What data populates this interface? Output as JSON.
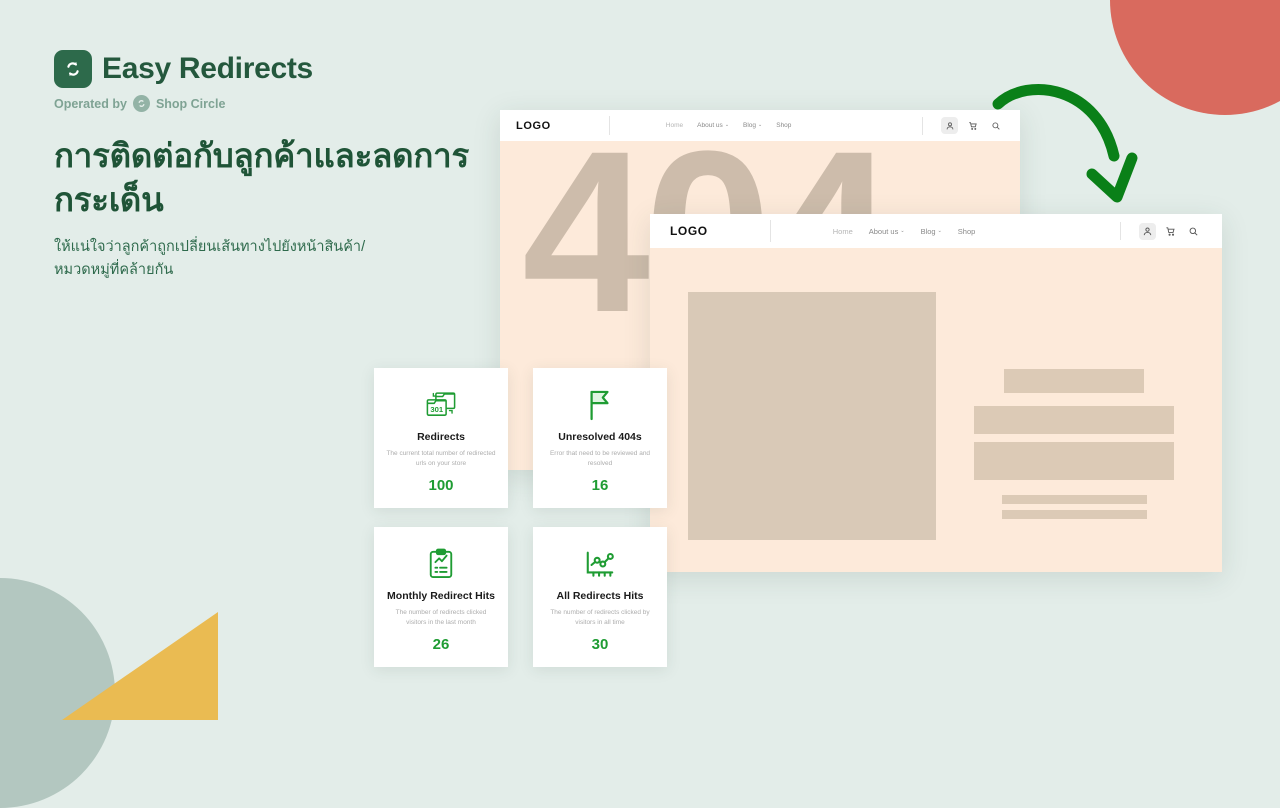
{
  "brand": {
    "logo_icon": "redirect-swap-icon",
    "title": "Easy Redirects",
    "operated_prefix": "Operated by",
    "operator_icon": "shop-circle-icon",
    "operator_name": "Shop Circle"
  },
  "hero": {
    "headline": "การติดต่อกับลูกค้าและลดการกระเด็น",
    "subheadline": "ให้แน่ใจว่าลูกค้าถูกเปลี่ยนเส้นทางไปยังหน้าสินค้า/หมวดหมู่ที่คล้ายกัน"
  },
  "browser_back": {
    "logo": "LOGO",
    "nav": [
      {
        "label": "Home",
        "caret": ""
      },
      {
        "label": "About us",
        "caret": "⌄"
      },
      {
        "label": "Blog",
        "caret": "⌄"
      },
      {
        "label": "Shop",
        "caret": ""
      }
    ],
    "icons": [
      "user-icon",
      "cart-icon",
      "search-icon"
    ],
    "error_code": "404"
  },
  "browser_front": {
    "logo": "LOGO",
    "nav": [
      {
        "label": "Home",
        "caret": ""
      },
      {
        "label": "About us",
        "caret": "⌄"
      },
      {
        "label": "Blog",
        "caret": "⌄"
      },
      {
        "label": "Shop",
        "caret": ""
      }
    ],
    "icons": [
      "user-icon",
      "cart-icon",
      "search-icon"
    ]
  },
  "arrow": {
    "icon": "curved-arrow-down-icon",
    "color": "#0a8018"
  },
  "cards": [
    {
      "icon": "folders-301-icon",
      "title": "Redirects",
      "desc": "The current total number of redirected urls on your store",
      "value": "100"
    },
    {
      "icon": "flag-icon",
      "title": "Unresolved 404s",
      "desc": "Error that need to be reviewed and resolved",
      "value": "16"
    },
    {
      "icon": "clipboard-chart-icon",
      "title": "Monthly Redirect Hits",
      "desc": "The number of redirects clicked visitors in the last month",
      "value": "26"
    },
    {
      "icon": "line-chart-icon",
      "title": "All Redirects Hits",
      "desc": "The number of redirects clicked by visitors in all time",
      "value": "30"
    }
  ],
  "colors": {
    "background": "#e3ede9",
    "brand_green": "#24583d",
    "accent_green": "#1f9c33",
    "arrow_green": "#0a8018",
    "page_cream": "#fdeada",
    "placeholder_tan": "#d9c9b7",
    "circle_red": "#d96a5e",
    "circle_sage": "#b3c7c0",
    "triangle_yellow": "#eabb52"
  }
}
